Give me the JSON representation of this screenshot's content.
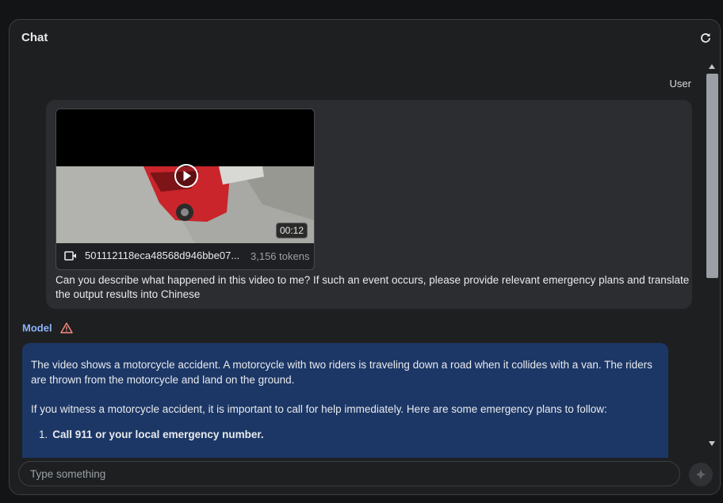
{
  "header": {
    "title": "Chat",
    "refresh_icon": "refresh-icon"
  },
  "user": {
    "label": "User",
    "video": {
      "duration": "00:12",
      "file_name": "501112118eca48568d946bbe07...",
      "tokens": "3,156 tokens",
      "icon": "video-file-icon"
    },
    "message": "Can you describe what happened in this video to me? If such an event occurs, please provide relevant emergency plans and translate the output results into Chinese"
  },
  "model": {
    "label": "Model",
    "warning_icon": "warning-icon",
    "paragraphs": [
      "The video shows a motorcycle accident. A motorcycle with two riders is traveling down a road when it collides with a van. The riders are thrown from the motorcycle and land on the ground.",
      "If you witness a motorcycle accident, it is important to call for help immediately. Here are some emergency plans to follow:"
    ],
    "list": [
      {
        "num": "1.",
        "text": "Call 911 or your local emergency number."
      }
    ]
  },
  "input": {
    "placeholder": "Type something"
  },
  "colors": {
    "panel": "#1e1f21",
    "user_bubble": "#2c2d30",
    "model_bubble": "#1c3766",
    "accent": "#8ab4f8",
    "warning": "#f28b82"
  }
}
